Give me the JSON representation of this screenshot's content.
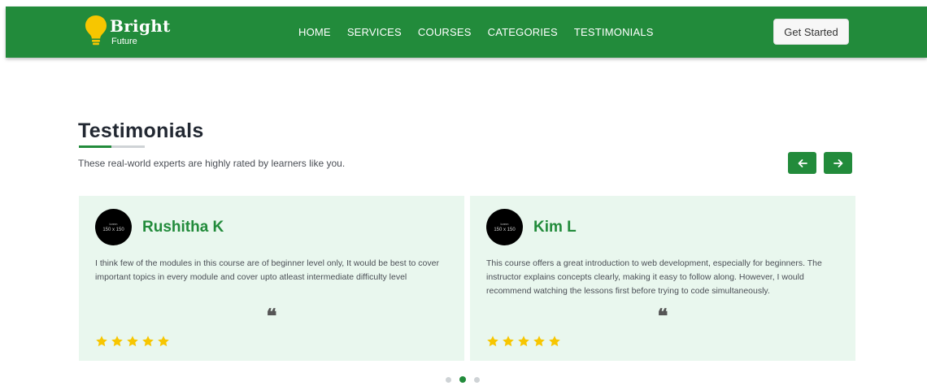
{
  "colors": {
    "brand": "#228b3b",
    "card_bg": "#e9f7ee",
    "star": "#f7c600"
  },
  "header": {
    "logo_title": "Bright",
    "logo_subtitle": "Future",
    "nav": [
      "HOME",
      "SERVICES",
      "COURSES",
      "CATEGORIES",
      "TESTIMONIALS"
    ],
    "cta_label": "Get Started"
  },
  "section": {
    "title": "Testimonials",
    "subtitle": "These real-world experts are highly rated by learners like you.",
    "prev_icon": "arrow-left-icon",
    "next_icon": "arrow-right-icon"
  },
  "testimonials": [
    {
      "name": "Rushitha K",
      "avatar_tiny": "lorem",
      "avatar_label": "150 x 150",
      "text": "I think few of the modules in this course are of beginner level only, It would be best to cover important topics in every module and cover upto atleast intermediate difficulty level",
      "quote": "❝",
      "rating": 5
    },
    {
      "name": "Kim L",
      "avatar_tiny": "lorem",
      "avatar_label": "150 x 150",
      "text": "This course offers a great introduction to web development, especially for beginners. The instructor explains concepts clearly, making it easy to follow along. However, I would recommend watching the lessons first before trying to code simultaneously.",
      "quote": "❝",
      "rating": 5
    }
  ],
  "carousel": {
    "pages": 3,
    "active_page": 2
  }
}
